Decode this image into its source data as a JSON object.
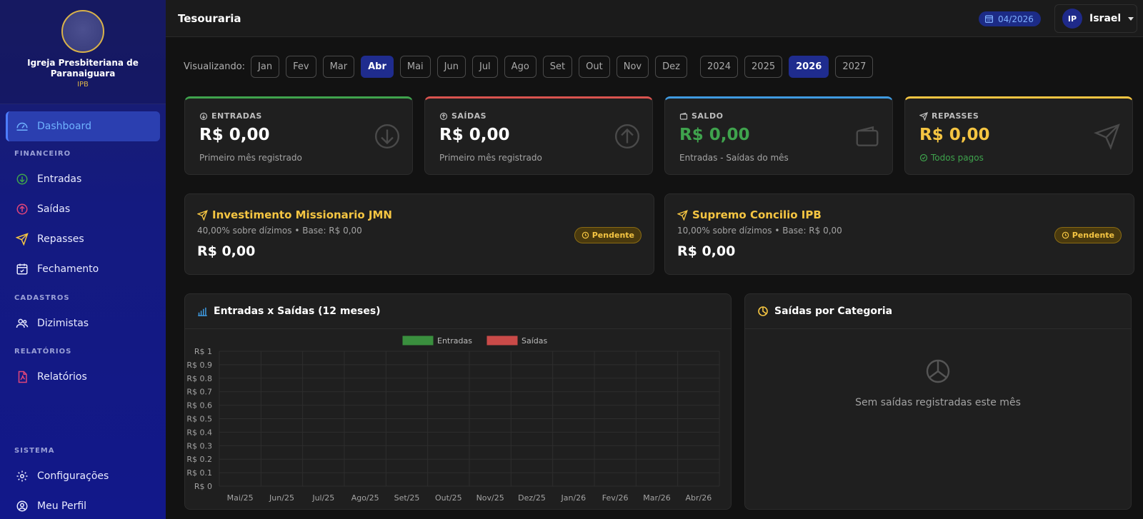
{
  "sidebar": {
    "church_name": "Igreja Presbiteriana de Paranaiguara",
    "church_abbr": "IPB",
    "items": {
      "dashboard": "Dashboard",
      "entradas": "Entradas",
      "saidas": "Saídas",
      "repasses": "Repasses",
      "fechamento": "Fechamento",
      "dizimistas": "Dizimistas",
      "relatorios": "Relatórios",
      "configuracoes": "Configurações",
      "perfil": "Meu Perfil"
    },
    "sections": {
      "financeiro": "FINANCEIRO",
      "cadastros": "CADASTROS",
      "relatorios": "RELATÓRIOS",
      "sistema": "SISTEMA"
    }
  },
  "header": {
    "title": "Tesouraria",
    "period": "04/2026",
    "user_initials": "IP",
    "user_name": "Israel"
  },
  "filter": {
    "label": "Visualizando:",
    "months": [
      "Jan",
      "Fev",
      "Mar",
      "Abr",
      "Mai",
      "Jun",
      "Jul",
      "Ago",
      "Set",
      "Out",
      "Nov",
      "Dez"
    ],
    "active_month": "Abr",
    "years": [
      "2024",
      "2025",
      "2026",
      "2027"
    ],
    "active_year": "2026"
  },
  "stats": {
    "entradas": {
      "label": "ENTRADAS",
      "value": "R$ 0,00",
      "sub": "Primeiro mês registrado",
      "color": "#3fa34d"
    },
    "saidas": {
      "label": "SAÍDAS",
      "value": "R$ 0,00",
      "sub": "Primeiro mês registrado",
      "color": "#d9534f"
    },
    "saldo": {
      "label": "SALDO",
      "value": "R$ 0,00",
      "sub": "Entradas - Saídas do mês",
      "color": "#3f9ae0"
    },
    "repasses": {
      "label": "REPASSES",
      "value": "R$ 0,00",
      "sub": "Todos pagos",
      "color": "#f5c542"
    }
  },
  "transfers": [
    {
      "title": "Investimento Missionario JMN",
      "desc": "40,00% sobre dízimos • Base: R$ 0,00",
      "value": "R$ 0,00",
      "status": "Pendente"
    },
    {
      "title": "Supremo Concilio IPB",
      "desc": "10,00% sobre dízimos • Base: R$ 0,00",
      "value": "R$ 0,00",
      "status": "Pendente"
    }
  ],
  "chart_title": "Entradas x Saídas (12 meses)",
  "chart_data": {
    "type": "bar",
    "categories": [
      "Mai/25",
      "Jun/25",
      "Jul/25",
      "Ago/25",
      "Set/25",
      "Out/25",
      "Nov/25",
      "Dez/25",
      "Jan/26",
      "Fev/26",
      "Mar/26",
      "Abr/26"
    ],
    "series": [
      {
        "name": "Entradas",
        "values": [
          0,
          0,
          0,
          0,
          0,
          0,
          0,
          0,
          0,
          0,
          0,
          0
        ],
        "color": "#3a8f3e"
      },
      {
        "name": "Saídas",
        "values": [
          0,
          0,
          0,
          0,
          0,
          0,
          0,
          0,
          0,
          0,
          0,
          0
        ],
        "color": "#c94a48"
      }
    ],
    "yticks": [
      "R$ 1",
      "R$ 0.9",
      "R$ 0.8",
      "R$ 0.7",
      "R$ 0.6",
      "R$ 0.5",
      "R$ 0.4",
      "R$ 0.3",
      "R$ 0.2",
      "R$ 0.1",
      "R$ 0"
    ],
    "ylim": [
      0,
      1
    ],
    "grid": true,
    "legend": "top-center"
  },
  "category_card": {
    "title": "Saídas por Categoria",
    "empty_text": "Sem saídas registradas este mês"
  }
}
